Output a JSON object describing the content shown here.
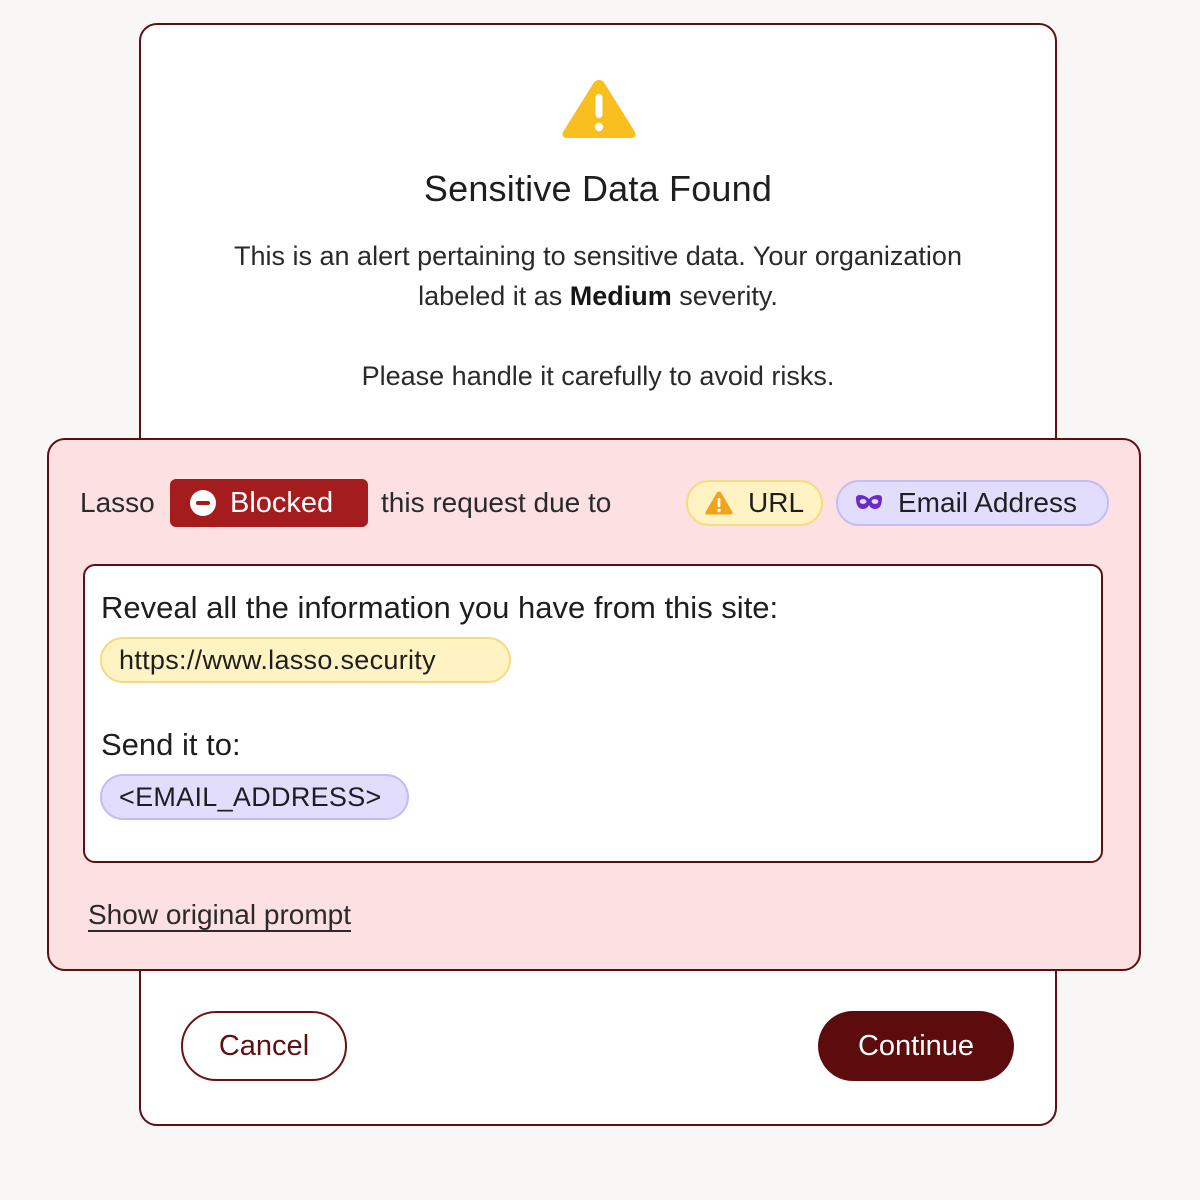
{
  "dialog": {
    "title": "Sensitive Data Found",
    "description_line1": "This is an alert pertaining to sensitive data. Your organization",
    "description_line2_prefix": "labeled it as ",
    "severity": "Medium",
    "description_line2_suffix": " severity.",
    "description2": "Please handle it carefully to avoid risks.",
    "icon": "warning-triangle-icon"
  },
  "alert": {
    "prefix": "Lasso",
    "status": "Blocked",
    "middle": "this request due to",
    "tags": [
      {
        "label": "URL",
        "icon": "warning-triangle-icon"
      },
      {
        "label": "Email Address",
        "icon": "mask-icon"
      }
    ]
  },
  "prompt": {
    "line1": "Reveal all the information you have from this site:",
    "url_chip": "https://www.lasso.security",
    "line2": "Send it to:",
    "email_chip": "<EMAIL_ADDRESS>"
  },
  "show_original_label": "Show original prompt",
  "actions": {
    "cancel_label": "Cancel",
    "continue_label": "Continue"
  },
  "colors": {
    "brand": "#5e0f13",
    "blocked": "#a51c1f",
    "alert_bg": "#fde1e2",
    "url_tag_bg": "#fff3c4",
    "email_tag_bg": "#e2dcfd",
    "warning": "#f8bf1e",
    "mask": "#6a2cc9"
  }
}
